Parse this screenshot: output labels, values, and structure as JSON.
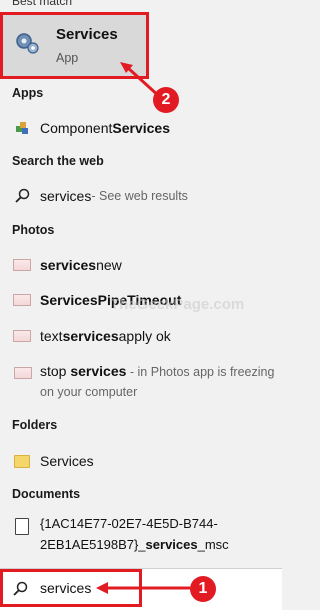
{
  "header": {
    "partial_label": "Best match"
  },
  "best_match": {
    "title": "Services",
    "subtitle": "App"
  },
  "apps": {
    "heading": "Apps",
    "items": [
      {
        "normal": "Component ",
        "bold": "Services"
      }
    ]
  },
  "web": {
    "heading": "Search the web",
    "query": "services",
    "suffix": " - See web results"
  },
  "photos": {
    "heading": "Photos",
    "items": [
      {
        "bold": "services",
        "normal": " new"
      },
      {
        "bold": "ServicesPipeTimeout",
        "normal": ""
      },
      {
        "pre": "text ",
        "bold": "services",
        "normal": " apply ok"
      },
      {
        "pre": "stop ",
        "bold": "services",
        "normal": " - in Photos app is freezing",
        "line2": "on your computer"
      }
    ]
  },
  "folders": {
    "heading": "Folders",
    "items": [
      {
        "label": "Services"
      }
    ]
  },
  "documents": {
    "heading": "Documents",
    "items": [
      {
        "line1": "{1AC14E77-02E7-4E5D-B744-",
        "line2_normal": "2EB1AE5198B7}_",
        "line2_bold": "services",
        "line2_tail": "_msc"
      }
    ]
  },
  "search": {
    "value": "services"
  },
  "callouts": {
    "one": "1",
    "two": "2"
  },
  "colors": {
    "accent": "#e21b23",
    "selected_bg": "#d9d9d9",
    "background": "#f1f1f1"
  },
  "watermark": "TheGeekPage.com"
}
